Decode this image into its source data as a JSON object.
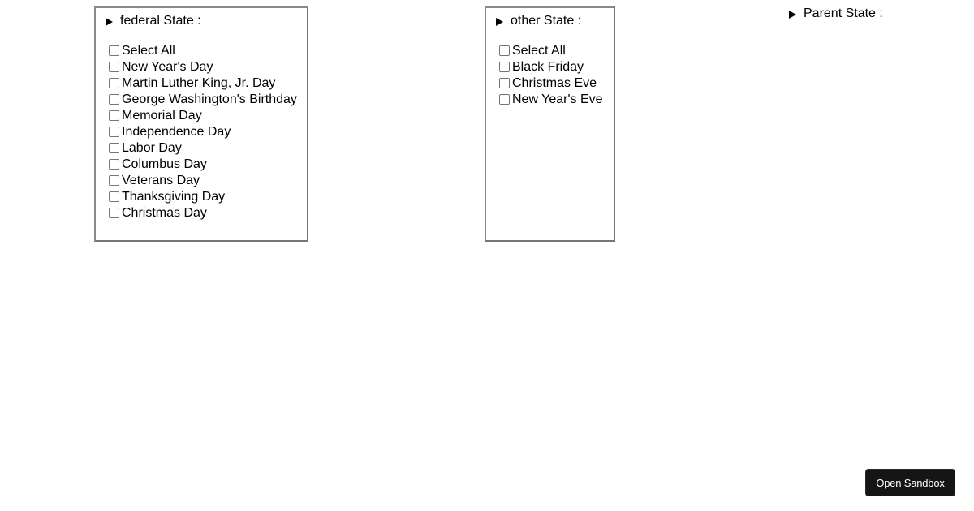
{
  "federal": {
    "summary": "federal State :",
    "items": [
      {
        "label": "Select All",
        "checked": false
      },
      {
        "label": "New Year's Day",
        "checked": false
      },
      {
        "label": "Martin Luther King, Jr. Day",
        "checked": false
      },
      {
        "label": "George Washington's Birthday",
        "checked": false
      },
      {
        "label": "Memorial Day",
        "checked": false
      },
      {
        "label": "Independence Day",
        "checked": false
      },
      {
        "label": "Labor Day",
        "checked": false
      },
      {
        "label": "Columbus Day",
        "checked": false
      },
      {
        "label": "Veterans Day",
        "checked": false
      },
      {
        "label": "Thanksgiving Day",
        "checked": false
      },
      {
        "label": "Christmas Day",
        "checked": false
      }
    ]
  },
  "other": {
    "summary": "other State :",
    "items": [
      {
        "label": "Select All",
        "checked": false
      },
      {
        "label": "Black Friday",
        "checked": false
      },
      {
        "label": "Christmas Eve",
        "checked": false
      },
      {
        "label": "New Year's Eve",
        "checked": false
      }
    ]
  },
  "parent": {
    "summary": "Parent State :"
  },
  "sandbox_button": {
    "label": "Open Sandbox"
  }
}
